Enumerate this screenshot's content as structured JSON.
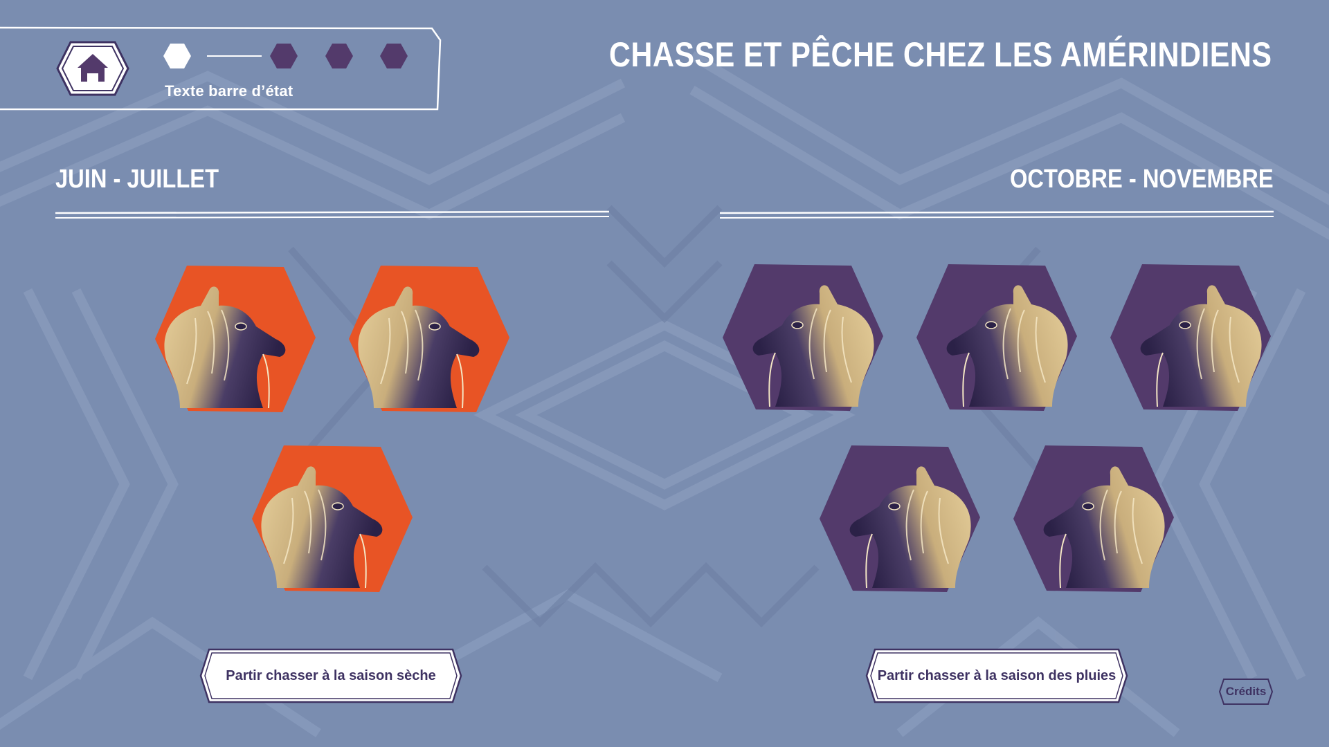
{
  "header": {
    "title": "CHASSE ET PÊCHE CHEZ LES AMÉRINDIENS",
    "status_text": "Texte barre d’état",
    "home_icon": "home-icon",
    "progress": {
      "total_steps": 4,
      "current_step": 1
    }
  },
  "seasons": {
    "dry": {
      "label": "JUIN - JUILLET",
      "token_count": 3,
      "token_icon": "tapir-icon",
      "button_label": "Partir chasser à la saison sèche",
      "color": "#e85425"
    },
    "wet": {
      "label": "OCTOBRE - NOVEMBRE",
      "token_count": 5,
      "token_icon": "tapir-icon",
      "button_label": "Partir chasser à la saison des pluies",
      "color": "#533a6b"
    }
  },
  "footer": {
    "credits_label": "Crédits"
  },
  "colors": {
    "background": "#7a8db0",
    "accent_orange": "#e85425",
    "accent_purple": "#533a6b",
    "text_dark": "#3e3262",
    "white": "#ffffff"
  }
}
